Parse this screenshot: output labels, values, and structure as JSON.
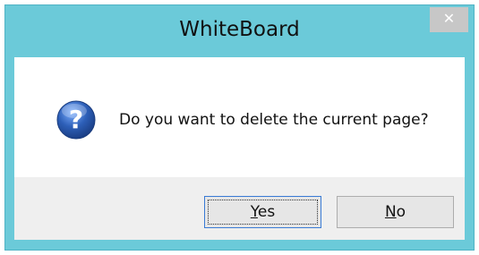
{
  "window": {
    "title": "WhiteBoard",
    "close_glyph": "✕"
  },
  "dialog": {
    "icon": "question-icon",
    "message": "Do you want to delete the current page?"
  },
  "buttons": {
    "yes": {
      "accel": "Y",
      "rest": "es"
    },
    "no": {
      "accel": "N",
      "rest": "o"
    }
  },
  "colors": {
    "titlebar": "#6bcad9",
    "icon_blue": "#2d5fb8"
  }
}
